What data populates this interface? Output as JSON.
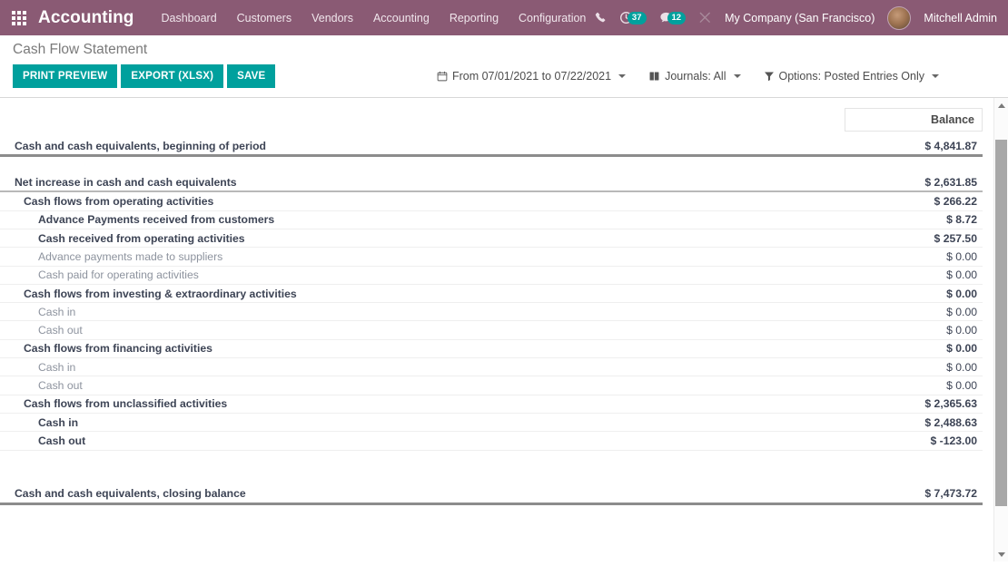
{
  "navbar": {
    "apps_icon": "apps-grid-icon",
    "brand": "Accounting",
    "menu": [
      {
        "label": "Dashboard"
      },
      {
        "label": "Customers"
      },
      {
        "label": "Vendors"
      },
      {
        "label": "Accounting"
      },
      {
        "label": "Reporting"
      },
      {
        "label": "Configuration"
      }
    ],
    "phone_icon": "phone-icon",
    "activity_icon": "clock-activity-icon",
    "activity_count": "37",
    "messages_icon": "chat-bubble-icon",
    "messages_count": "12",
    "tools_icon": "crossed-tools-icon",
    "company": "My Company (San Francisco)",
    "avatar": "user-avatar",
    "user": "Mitchell Admin"
  },
  "control_panel": {
    "title": "Cash Flow Statement",
    "buttons": [
      {
        "label": "PRINT PREVIEW",
        "name": "print-preview-button"
      },
      {
        "label": "EXPORT (XLSX)",
        "name": "export-xlsx-button"
      },
      {
        "label": "SAVE",
        "name": "save-button"
      }
    ],
    "filters": [
      {
        "icon": "calendar-icon",
        "label": "From 07/01/2021 to 07/22/2021",
        "name": "date-filter"
      },
      {
        "icon": "book-icon",
        "label": "Journals: All",
        "name": "journals-filter"
      },
      {
        "icon": "funnel-icon",
        "label": "Options: Posted Entries Only",
        "name": "options-filter"
      }
    ]
  },
  "report": {
    "columns": {
      "balance": "Balance"
    },
    "rows": [
      {
        "label": "Cash and cash equivalents, beginning of period",
        "value": "$ 4,841.87",
        "bold": true,
        "caret": true,
        "indent": 0,
        "line": "thick"
      },
      {
        "label": "",
        "value": "",
        "bold": false,
        "caret": false,
        "indent": 0,
        "line": "none",
        "spacer": true
      },
      {
        "label": "Net increase in cash and cash equivalents",
        "value": "$ 2,631.85",
        "bold": true,
        "caret": false,
        "indent": 0,
        "line": "med"
      },
      {
        "label": "Cash flows from operating activities",
        "value": "$ 266.22",
        "bold": true,
        "caret": false,
        "indent": 1,
        "line": "thin"
      },
      {
        "label": "Advance Payments received from customers",
        "value": "$ 8.72",
        "bold": true,
        "caret": true,
        "indent": 2,
        "line": "thin"
      },
      {
        "label": "Cash received from operating activities",
        "value": "$ 257.50",
        "bold": true,
        "caret": true,
        "indent": 2,
        "line": "thin"
      },
      {
        "label": "Advance payments made to suppliers",
        "value": "$ 0.00",
        "bold": false,
        "caret": false,
        "indent": 2,
        "line": "thin"
      },
      {
        "label": "Cash paid for operating activities",
        "value": "$ 0.00",
        "bold": false,
        "caret": false,
        "indent": 2,
        "line": "thin"
      },
      {
        "label": "Cash flows from investing & extraordinary activities",
        "value": "$ 0.00",
        "bold": true,
        "caret": false,
        "indent": 1,
        "line": "thin"
      },
      {
        "label": "Cash in",
        "value": "$ 0.00",
        "bold": false,
        "caret": false,
        "indent": 2,
        "line": "thin"
      },
      {
        "label": "Cash out",
        "value": "$ 0.00",
        "bold": false,
        "caret": false,
        "indent": 2,
        "line": "thin"
      },
      {
        "label": "Cash flows from financing activities",
        "value": "$ 0.00",
        "bold": true,
        "caret": false,
        "indent": 1,
        "line": "thin"
      },
      {
        "label": "Cash in",
        "value": "$ 0.00",
        "bold": false,
        "caret": false,
        "indent": 2,
        "line": "thin"
      },
      {
        "label": "Cash out",
        "value": "$ 0.00",
        "bold": false,
        "caret": false,
        "indent": 2,
        "line": "thin"
      },
      {
        "label": "Cash flows from unclassified activities",
        "value": "$ 2,365.63",
        "bold": true,
        "caret": false,
        "indent": 1,
        "line": "thin"
      },
      {
        "label": "Cash in",
        "value": "$ 2,488.63",
        "bold": true,
        "caret": true,
        "indent": 2,
        "line": "thin"
      },
      {
        "label": "Cash out",
        "value": "$ -123.00",
        "bold": true,
        "caret": true,
        "indent": 2,
        "line": "thin"
      },
      {
        "label": "",
        "value": "",
        "bold": false,
        "caret": false,
        "indent": 0,
        "line": "none",
        "spacer": true
      },
      {
        "label": "",
        "value": "",
        "bold": false,
        "caret": false,
        "indent": 0,
        "line": "none",
        "spacer": true
      },
      {
        "label": "Cash and cash equivalents, closing balance",
        "value": "$ 7,473.72",
        "bold": true,
        "caret": true,
        "indent": 0,
        "line": "thick"
      }
    ]
  },
  "colors": {
    "brand_purple": "#8a5a74",
    "accent_teal": "#00a09d",
    "text_dark": "#3d4455",
    "text_muted": "#8d939e"
  }
}
